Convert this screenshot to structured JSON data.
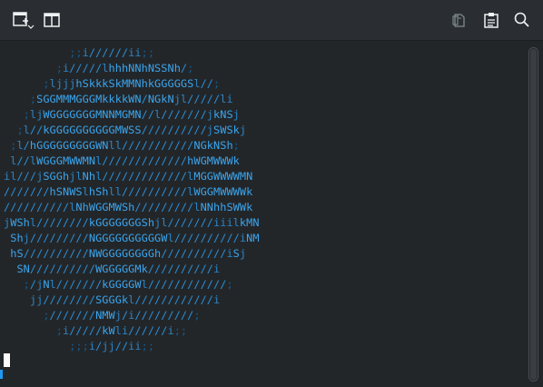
{
  "toolbar": {
    "left": [
      {
        "icon": "new-tab-icon",
        "has_dropdown": true
      },
      {
        "icon": "split-view-icon"
      }
    ],
    "right": [
      {
        "icon": "copy-icon"
      },
      {
        "icon": "paste-icon"
      },
      {
        "icon": "search-icon"
      }
    ]
  },
  "terminal": {
    "foreground": "#1d99f3",
    "background": "#232629",
    "ascii_lines": [
      "          ;;i//////ii;;",
      "        ;i/////lhhhNNhNSSNh/;",
      "      ;ljjjhSkkkSkMMNhkGGGGGSl//;",
      "    ;SGGMMMGGGMkkkkWN/NGkNjl/////li",
      "   ;ljWGGGGGGGMNNMGMN//l///////jkNSj",
      "  ;l//kGGGGGGGGGGMWSS//////////jSWSkj",
      " ;l/hGGGGGGGGGWNll///////////NGkNSh;",
      " l//lWGGGMWWMNl/////////////hWGMWWWk",
      "il///jSGGhjlNhl/////////////lMGGWWWWMN",
      "///////hSNWSlhShll//////////lWGGMWWWWk",
      "//////////lNhWGGMWSh/////////lNNhhSWWk",
      "jWShl////////kGGGGGGGShjl///////iiilkMN",
      " Shj/////////NGGGGGGGGGGWl//////////iNM",
      " hS//////////NWGGGGGGGGh//////////iSj",
      "  SN//////////WGGGGGMk//////////i",
      "   ;/jNl///////kGGGGWl////////////;",
      "    jj////////SGGGkl////////////i",
      "      ;///////NMWj/i/////////;",
      "        ;i/////kWli//////i;;",
      "          ;;;i/jj//ii;;"
    ]
  }
}
